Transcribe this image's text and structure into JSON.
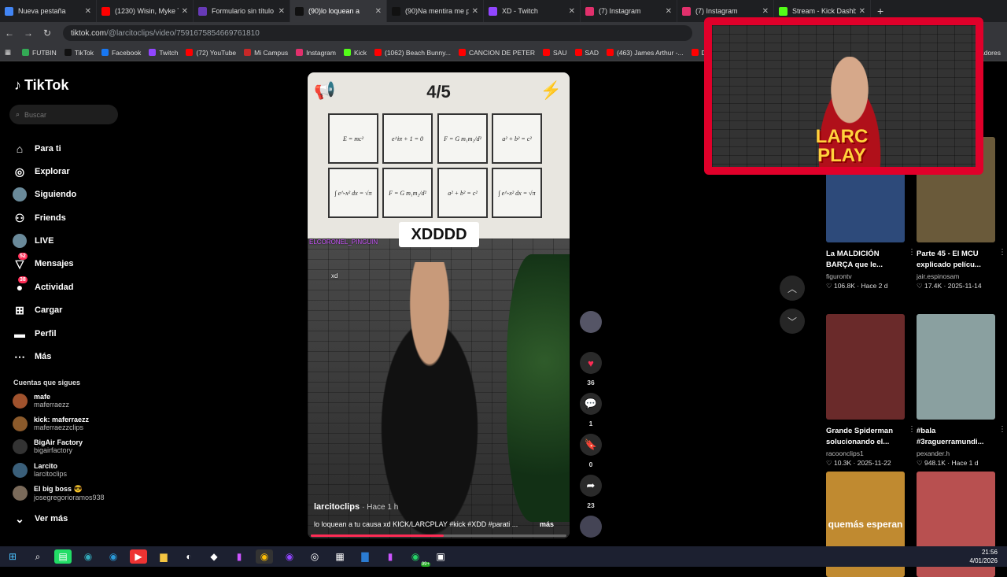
{
  "browser": {
    "tabs": [
      {
        "title": "Nueva pestaña",
        "color": "#4285f4",
        "active": false
      },
      {
        "title": "(1230) Wisin, Myke T",
        "color": "#ff0000",
        "active": false
      },
      {
        "title": "Formulario sin título",
        "color": "#673ab7",
        "active": false
      },
      {
        "title": "(90)lo loquean a",
        "color": "#111111",
        "active": true
      },
      {
        "title": "(90)Na mentira me p",
        "color": "#111111",
        "active": false
      },
      {
        "title": "XD - Twitch",
        "color": "#9146ff",
        "active": false
      },
      {
        "title": "(7) Instagram",
        "color": "#e1306c",
        "active": false
      },
      {
        "title": "(7) Instagram",
        "color": "#e1306c",
        "active": false
      },
      {
        "title": "Stream - Kick Dashb",
        "color": "#53fc18",
        "active": false
      }
    ],
    "url_host": "tiktok.com",
    "url_path": "/@larcitoclips/video/7591675854669761810",
    "bookmarks": [
      {
        "label": "FUTBIN",
        "color": "#33aa55"
      },
      {
        "label": "TikTok",
        "color": "#111111"
      },
      {
        "label": "Facebook",
        "color": "#1877f2"
      },
      {
        "label": "Twitch",
        "color": "#9146ff"
      },
      {
        "label": "(72) YouTube",
        "color": "#ff0000"
      },
      {
        "label": "Mi Campus",
        "color": "#c62828"
      },
      {
        "label": "Instagram",
        "color": "#e1306c"
      },
      {
        "label": "Kick",
        "color": "#53fc18"
      },
      {
        "label": "(1062) Beach Bunny...",
        "color": "#ff0000"
      },
      {
        "label": "CANCION DE PETER",
        "color": "#ff0000"
      },
      {
        "label": "SAU",
        "color": "#ff0000"
      },
      {
        "label": "SAD",
        "color": "#ff0000"
      },
      {
        "label": "(463) James Arthur -...",
        "color": "#ff0000"
      },
      {
        "label": "DRA",
        "color": "#ff0000"
      }
    ],
    "bookmarks_more": "adores"
  },
  "sidebar": {
    "logo": "TikTok",
    "search_placeholder": "Buscar",
    "nav": [
      {
        "label": "Para ti",
        "icon": "home-icon",
        "glyph": "⌂"
      },
      {
        "label": "Explorar",
        "icon": "compass-icon",
        "glyph": "◎"
      },
      {
        "label": "Siguiendo",
        "icon": "avatar-icon",
        "glyph": "●"
      },
      {
        "label": "Friends",
        "icon": "friends-icon",
        "glyph": "⚇"
      },
      {
        "label": "LIVE",
        "icon": "avatar-icon",
        "glyph": "●"
      },
      {
        "label": "Mensajes",
        "icon": "messages-icon",
        "glyph": "▽",
        "badge": "52"
      },
      {
        "label": "Actividad",
        "icon": "activity-icon",
        "glyph": "●",
        "badge": "38"
      },
      {
        "label": "Cargar",
        "icon": "upload-icon",
        "glyph": "⊞"
      },
      {
        "label": "Perfil",
        "icon": "profile-icon",
        "glyph": "▬"
      },
      {
        "label": "Más",
        "icon": "more-icon",
        "glyph": "⋯"
      }
    ],
    "following_title": "Cuentas que sigues",
    "accounts": [
      {
        "name": "mafe",
        "handle": "maferraezz",
        "color": "#a0522d"
      },
      {
        "name": "kick: maferraezz",
        "handle": "maferraezzclips",
        "color": "#8b5a2b"
      },
      {
        "name": "BigAir Factory",
        "handle": "bigairfactory",
        "color": "#333333"
      },
      {
        "name": "Larcito",
        "handle": "larcitoclips",
        "color": "#3a5f7a"
      },
      {
        "name": "El big boss 😎",
        "handle": "josegregorioramos938",
        "color": "#7a6a5a"
      }
    ],
    "see_more": "Ver más"
  },
  "video": {
    "counter": "4/5",
    "equations": [
      "E = mc²",
      "e^iπ + 1 = 0",
      "F = G m₁m₂/d²",
      "a² + b² = c²",
      "∫ e^-x² dx = √π",
      "F = G m₁m₂/d²",
      "a² + b² = c²",
      "∫ e^-x² dx = √π"
    ],
    "caption_overlay": "XDDDD",
    "chat_name": "ELCORONEL_PINGUIN",
    "chat_line": "xd",
    "author": "larcitoclips",
    "time_ago": "· Hace 1 h",
    "description": "lo loquean a tu causa xd KICK/LARCPLAY #kick  #XDD #parati ...",
    "more": "más",
    "progress": 0.52
  },
  "actions": {
    "likes": "36",
    "comments": "1",
    "saves": "0",
    "shares": "23"
  },
  "overlay": {
    "brand_line1": "LARC",
    "brand_line2": "PLAY"
  },
  "related": [
    {
      "title": "La MALDICIÓN BARÇA que le...",
      "author": "figurontv",
      "stats": "♡ 106.8K · Hace 2 d",
      "color": "#2d4a7a"
    },
    {
      "title": "Parte 45 - El MCU explicado pelícu...",
      "author": "jair.espinosam",
      "stats": "♡ 17.4K · 2025-11-14",
      "color": "#6a5a3a"
    },
    {
      "title": "Grande Spiderman solucionando el...",
      "author": "racoonclips1",
      "stats": "♡ 10.3K · 2025-11-22",
      "color": "#6a2a2a"
    },
    {
      "title": "#bala #3raguerramundi...",
      "author": "pexander.h",
      "stats": "♡ 948.1K · Hace 1 d",
      "color": "#8aa0a0"
    },
    {
      "title": "",
      "author": "",
      "stats": "",
      "color": "#c08a30",
      "thumb_text": "quemás esperan"
    },
    {
      "title": "",
      "author": "",
      "stats": "",
      "color": "#b85050"
    }
  ],
  "taskbar": {
    "time": "21:56",
    "date": "4/01/2026",
    "badge": "99+"
  }
}
